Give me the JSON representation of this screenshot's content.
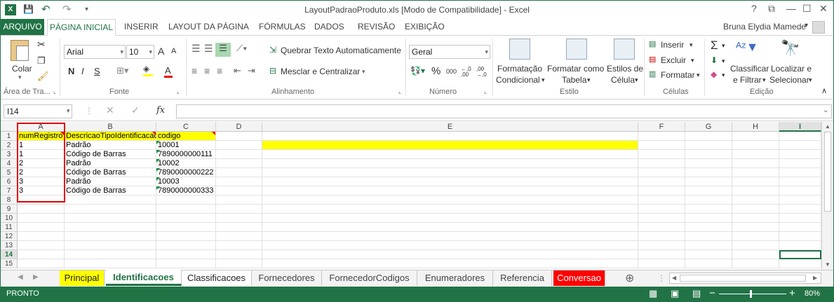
{
  "window": {
    "title": "LayoutPadraoProduto.xls  [Modo de Compatibilidade] - Excel",
    "help": "?",
    "restore_ribbon": "⧉",
    "minimize": "—",
    "maximize": "☐",
    "close": "✕"
  },
  "quick_access": {
    "save": "💾",
    "undo": "↶",
    "redo": "↷",
    "customize": "▾"
  },
  "tabs": [
    "ARQUIVO",
    "PÁGINA INICIAL",
    "INSERIR",
    "LAYOUT DA PÁGINA",
    "FÓRMULAS",
    "DADOS",
    "REVISÃO",
    "EXIBIÇÃO"
  ],
  "user": {
    "name": "Bruna Elydia Mamede",
    "dropdown": "▾"
  },
  "ribbon": {
    "clipboard": {
      "label": "Área de Tra...",
      "paste": "Colar",
      "paste_arrow": "▾"
    },
    "font": {
      "label": "Fonte",
      "name": "Arial",
      "size": "10",
      "grow": "A",
      "shrink": "A",
      "bold": "N",
      "italic": "I",
      "underline": "S"
    },
    "alignment": {
      "label": "Alinhamento",
      "wrap": "Quebrar Texto Automaticamente",
      "merge": "Mesclar e Centralizar"
    },
    "number": {
      "label": "Número",
      "format": "Geral",
      "percent": "%",
      "thousands": "000",
      "inc_dec": "←,0 ,00",
      "dec_dec": ",00 →,0"
    },
    "styles": {
      "label": "Estilo",
      "cond_format_1": "Formatação",
      "cond_format_2": "Condicional",
      "table_1": "Formatar como",
      "table_2": "Tabela",
      "cell_styles_1": "Estilos de",
      "cell_styles_2": "Célula"
    },
    "cells": {
      "label": "Células",
      "insert": "Inserir",
      "delete": "Excluir",
      "format": "Formatar"
    },
    "editing": {
      "label": "Edição",
      "sort_1": "Classificar",
      "sort_2": "e Filtrar",
      "find_1": "Localizar e",
      "find_2": "Selecionar",
      "collapse": "∧"
    }
  },
  "formula_bar": {
    "name_box": "I14",
    "fx": "fx",
    "cancel": "✕",
    "enter": "✓",
    "value": ""
  },
  "grid": {
    "columns": [
      "A",
      "B",
      "C",
      "D",
      "E",
      "F",
      "G",
      "H",
      "I"
    ],
    "rows": [
      "1",
      "2",
      "3",
      "4",
      "5",
      "6",
      "7",
      "8",
      "9",
      "10",
      "11",
      "12",
      "13",
      "14",
      "15"
    ],
    "cells": [
      [
        "numRegistro",
        "DescricaoTipoIdentificacao",
        "codigo"
      ],
      [
        "1",
        "Padrão",
        "10001"
      ],
      [
        "1",
        "Código de Barras",
        "7890000000111"
      ],
      [
        "2",
        "Padrão",
        "10002"
      ],
      [
        "2",
        "Código de Barras",
        "7890000000222"
      ],
      [
        "3",
        "Padrão",
        "10003"
      ],
      [
        "3",
        "Código de Barras",
        "7890000000333"
      ]
    ],
    "selected_cell": "I14"
  },
  "sheets": [
    "Principal",
    "Identificacoes",
    "Classificacoes",
    "Fornecedores",
    "FornecedorCodigos",
    "Enumeradores",
    "Referencia",
    "Conversao"
  ],
  "status": {
    "ready": "PRONTO",
    "zoom": "80%",
    "zoom_minus": "−",
    "zoom_plus": "+"
  },
  "colors": {
    "accent": "#217346",
    "yellow": "#ffff00",
    "red_tab": "#ff0000",
    "selection_box": "#e00000"
  }
}
